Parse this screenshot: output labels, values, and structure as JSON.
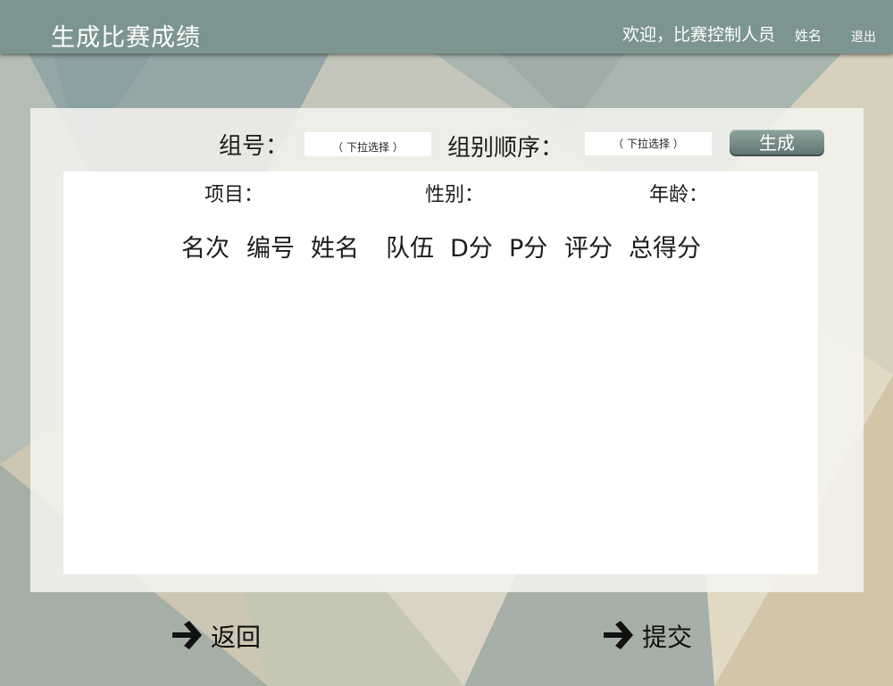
{
  "header": {
    "title": "生成比赛成绩",
    "welcome": "欢迎，比赛控制人员",
    "username": "姓名",
    "logout": "退出"
  },
  "form": {
    "group_label": "组号：",
    "group_select": "（ 下拉选择 ）",
    "order_label": "组别顺序：",
    "order_select": "（ 下拉选择 ）",
    "generate_button": "生成"
  },
  "filters": {
    "event": "项目：",
    "gender": "性别：",
    "age": "年龄："
  },
  "table": {
    "columns": [
      "名次",
      "编号",
      "姓名",
      "队伍",
      "D分",
      "P分",
      "评分",
      "总得分"
    ]
  },
  "footer": {
    "back": "返回",
    "submit": "提交"
  },
  "colors": {
    "header_bar": "#7d9590",
    "button": "#6f8581"
  },
  "icons": {
    "back": "arrow-right-icon",
    "submit": "arrow-right-icon"
  }
}
